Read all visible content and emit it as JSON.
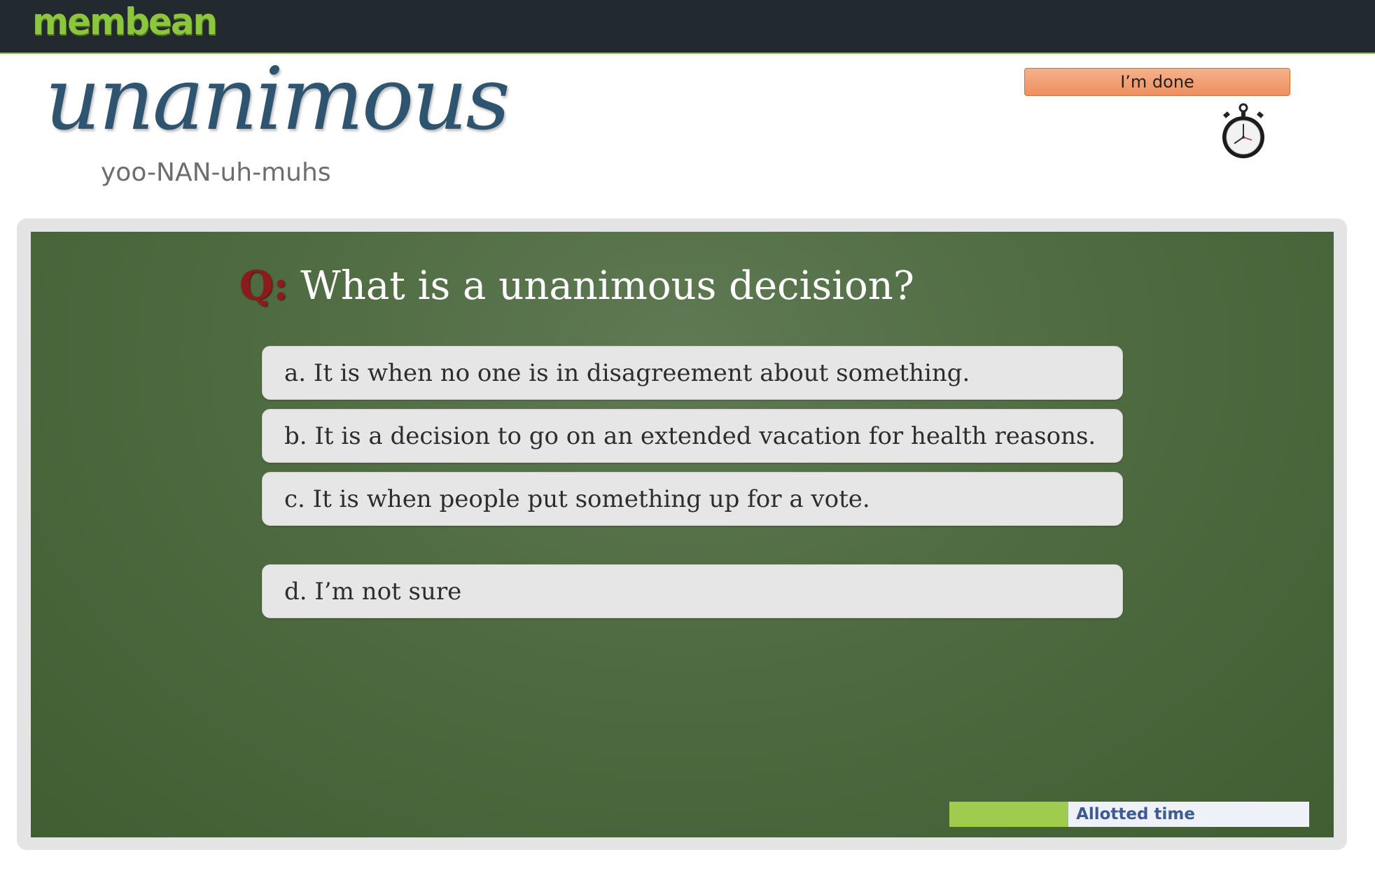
{
  "header": {
    "logo_text": "membean"
  },
  "word": {
    "text": "unanimous",
    "pronunciation": "yoo-NAN-uh-muhs"
  },
  "controls": {
    "done_label": "I’m done",
    "timer_icon": "stopwatch-icon"
  },
  "quiz": {
    "prefix": "Q:",
    "question": "What is a unanimous decision?",
    "answers": [
      {
        "label": "a. It is when no one is in disagreement about something."
      },
      {
        "label": "b. It is a decision to go on an extended vacation for health reasons."
      },
      {
        "label": "c. It is when people put something up for a vote."
      },
      {
        "label": "d. I’m not sure"
      }
    ]
  },
  "timer": {
    "label": "Allotted time",
    "fill_fraction": 0.33,
    "fill_color": "#9fcb4f",
    "track_color": "#eef2f8"
  },
  "colors": {
    "topbar": "#222a2f",
    "board": "#4f6b41",
    "word": "#2f5470",
    "done_button": "#ef905d"
  }
}
